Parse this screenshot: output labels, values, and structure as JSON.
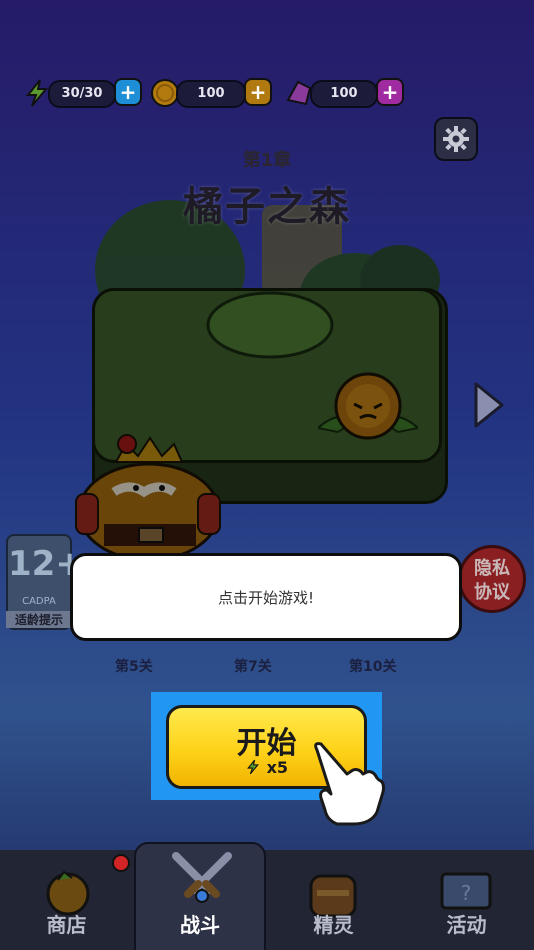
{
  "resources": {
    "energy": {
      "value": "30/30",
      "icon": "lightning-icon",
      "color": "#7ac943"
    },
    "coins": {
      "value": "100",
      "icon": "coin-icon",
      "color": "#f5a623"
    },
    "gems": {
      "value": "100",
      "icon": "gem-icon",
      "color": "#c04dd8"
    }
  },
  "chapter": {
    "number": "第1章",
    "name": "橘子之森"
  },
  "age_rating": {
    "rating": "12+",
    "org": "CADPA",
    "tip": "适龄提示"
  },
  "privacy": {
    "line1": "隐私",
    "line2": "协议"
  },
  "dialog": {
    "text": "点击开始游戏!"
  },
  "levels": [
    "第5关",
    "第7关",
    "第10关"
  ],
  "start_button": {
    "label": "开始",
    "cost": "x5"
  },
  "nav": {
    "tabs": [
      {
        "label": "商店",
        "icon": "shop-icon",
        "badge": true
      },
      {
        "label": "战斗",
        "icon": "swords-icon",
        "active": true
      },
      {
        "label": "精灵",
        "icon": "sprite-icon"
      },
      {
        "label": "活动",
        "icon": "event-icon"
      }
    ]
  },
  "colors": {
    "accent_yellow": "#ffd21a",
    "highlight_blue": "#2196f3",
    "nav_bg": "#222533"
  }
}
